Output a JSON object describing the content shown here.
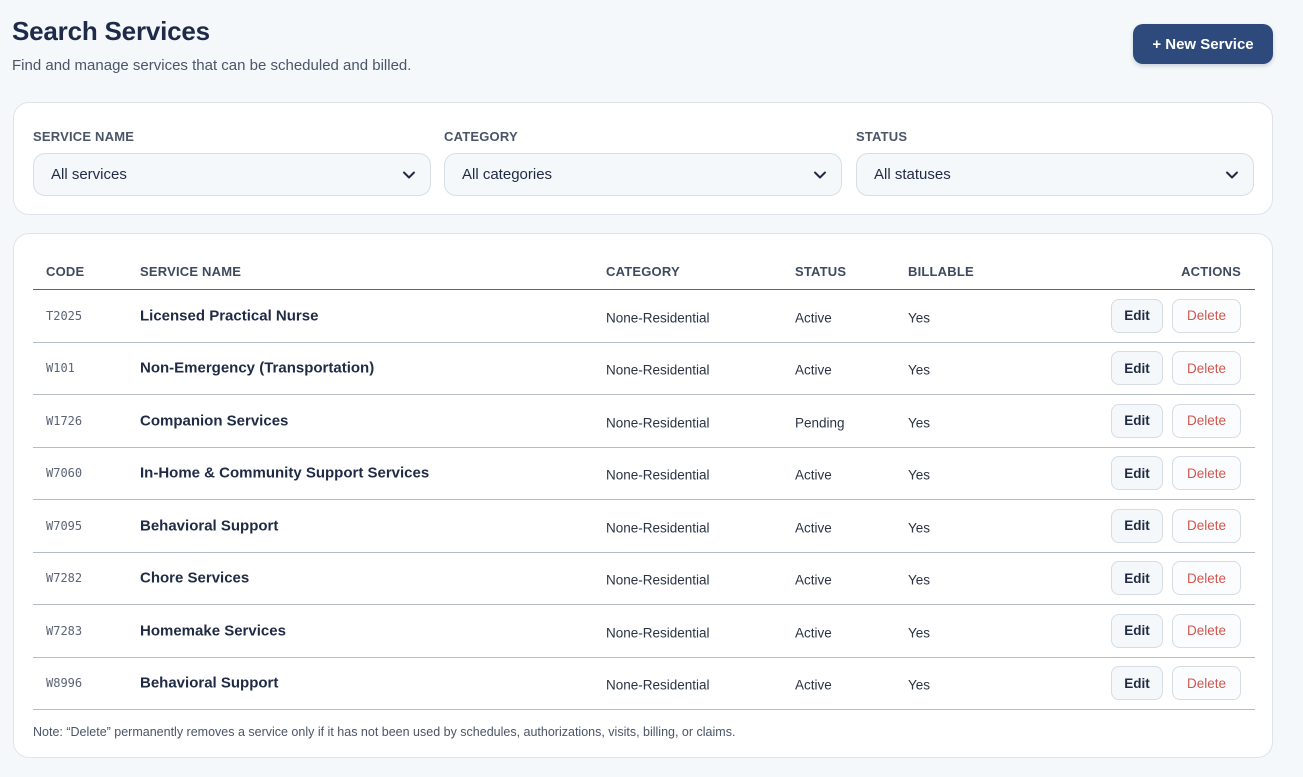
{
  "header": {
    "title": "Search Services",
    "subtitle": "Find and manage services that can be scheduled and billed.",
    "new_button_label": "+ New Service"
  },
  "filters": {
    "service_name": {
      "label": "SERVICE NAME",
      "value": "All services"
    },
    "category": {
      "label": "CATEGORY",
      "value": "All categories"
    },
    "status": {
      "label": "STATUS",
      "value": "All statuses"
    }
  },
  "table": {
    "columns": {
      "code": "CODE",
      "name": "SERVICE NAME",
      "category": "CATEGORY",
      "status": "STATUS",
      "billable": "BILLABLE",
      "actions": "ACTIONS"
    },
    "edit_label": "Edit",
    "delete_label": "Delete",
    "rows": [
      {
        "code": "T2025",
        "name": "Licensed Practical Nurse",
        "category": "None-Residential",
        "status": "Active",
        "billable": "Yes"
      },
      {
        "code": "W101",
        "name": "Non-Emergency (Transportation)",
        "category": "None-Residential",
        "status": "Active",
        "billable": "Yes"
      },
      {
        "code": "W1726",
        "name": "Companion Services",
        "category": "None-Residential",
        "status": "Pending",
        "billable": "Yes"
      },
      {
        "code": "W7060",
        "name": "In-Home & Community Support Services",
        "category": "None-Residential",
        "status": "Active",
        "billable": "Yes"
      },
      {
        "code": "W7095",
        "name": "Behavioral Support",
        "category": "None-Residential",
        "status": "Active",
        "billable": "Yes"
      },
      {
        "code": "W7282",
        "name": "Chore Services",
        "category": "None-Residential",
        "status": "Active",
        "billable": "Yes"
      },
      {
        "code": "W7283",
        "name": "Homemake Services",
        "category": "None-Residential",
        "status": "Active",
        "billable": "Yes"
      },
      {
        "code": "W8996",
        "name": "Behavioral Support",
        "category": "None-Residential",
        "status": "Active",
        "billable": "Yes"
      }
    ],
    "note": "Note: “Delete” permanently removes a service only if it has not been used by schedules, authorizations, visits, billing, or claims."
  },
  "colors": {
    "primary": "#2e4a7d",
    "danger": "#d0564f",
    "background": "#f5f8fa"
  },
  "icons": {
    "select_chevron": "chevron-down-icon"
  }
}
